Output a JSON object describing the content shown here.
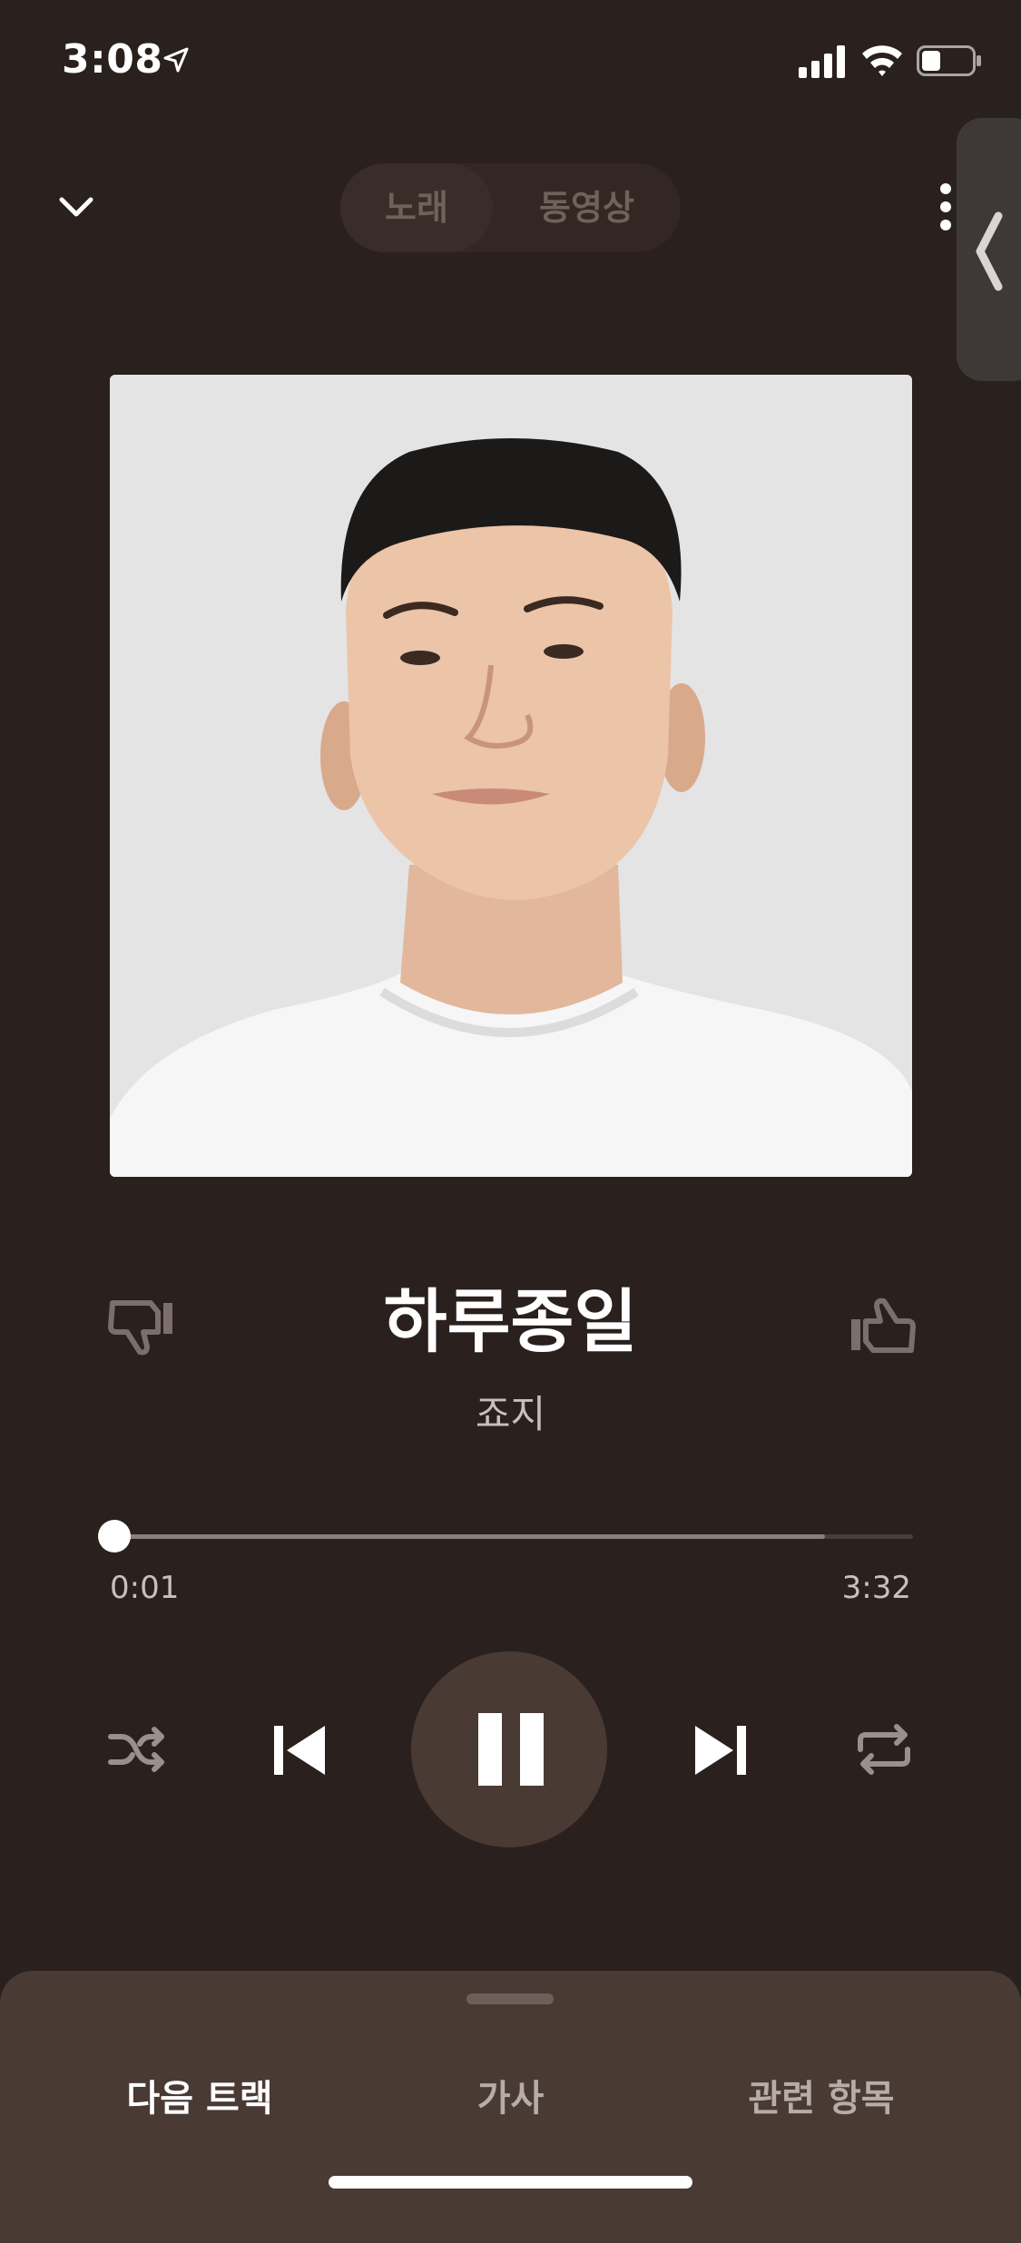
{
  "status_bar": {
    "time": "3:08"
  },
  "header": {
    "tabs": [
      {
        "label": "노래",
        "selected": true
      },
      {
        "label": "동영상",
        "selected": false
      }
    ]
  },
  "song": {
    "title": "하루종일",
    "artist": "죠지"
  },
  "progress": {
    "current_time": "0:01",
    "total_time": "3:32",
    "played_fraction": 0.005,
    "buffered_fraction": 0.89
  },
  "player": {
    "state": "playing"
  },
  "bottom_tabs": [
    {
      "label": "다음 트랙"
    },
    {
      "label": "가사"
    },
    {
      "label": "관련 항목"
    }
  ],
  "colors": {
    "background": "#2a201d",
    "sheet": "#4a3a34",
    "play_button": "#4a3a34",
    "text_secondary": "#c9bfbb"
  }
}
